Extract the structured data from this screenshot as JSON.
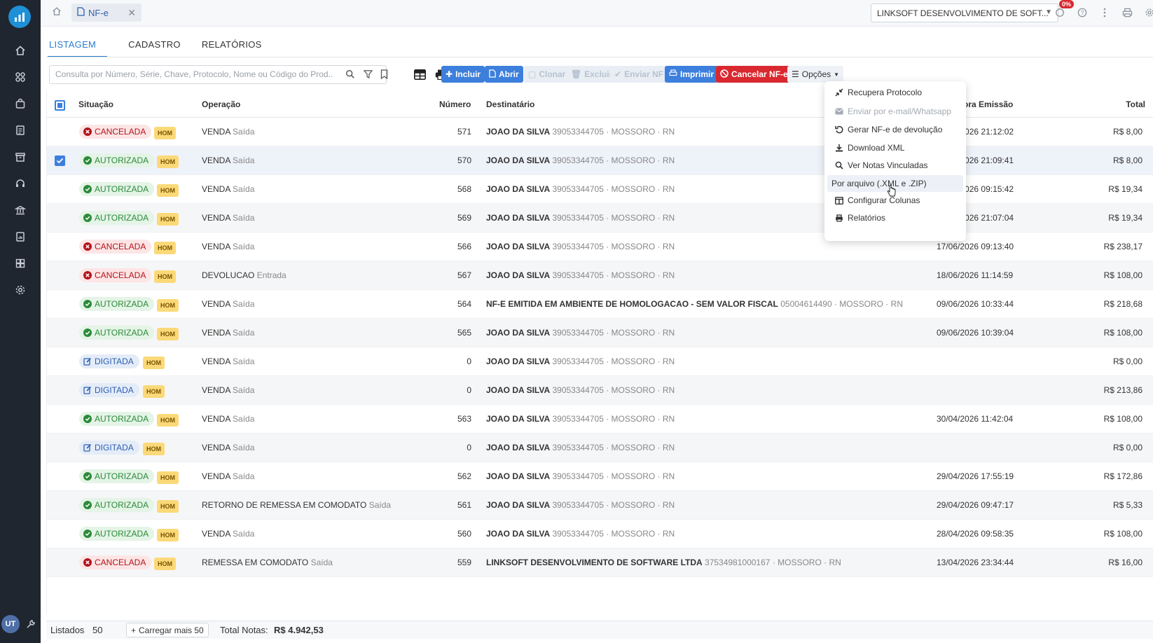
{
  "app": {
    "tab_label": "NF-e",
    "company": "LINKSOFT DESENVOLVIMENTO DE SOFT...",
    "notification_badge": "0%",
    "user_initials": "UT"
  },
  "tabs": [
    "LISTAGEM",
    "CADASTRO",
    "RELATÓRIOS"
  ],
  "search": {
    "placeholder": "Consulta por Número, Série, Chave, Protocolo, Nome ou Código do Prod..."
  },
  "toolbar": {
    "incluir": "Incluir",
    "abrir": "Abrir",
    "clonar": "Clonar",
    "excluir": "Excluir",
    "enviar": "Enviar NF",
    "imprimir": "Imprimir",
    "cancelar": "Cancelar NF-e",
    "opcoes": "Opções"
  },
  "columns": {
    "situacao": "Situação",
    "operacao": "Operação",
    "numero": "Número",
    "destinatario": "Destinatário",
    "data": "Data/Hora Emissão",
    "total": "Total"
  },
  "rows": [
    {
      "status": "CANCELADA",
      "kind": "canc",
      "env": "HOM",
      "op": "VENDA",
      "op_sub": "Saída",
      "num": "571",
      "dest": "JOAO DA SILVA",
      "dest_sub": "39053344705 · MOSSORO · RN",
      "date": "27/06/2026 21:12:02",
      "total": "R$ 8,00"
    },
    {
      "status": "AUTORIZADA",
      "kind": "aut",
      "env": "HOM",
      "op": "VENDA",
      "op_sub": "Saída",
      "num": "570",
      "dest": "JOAO DA SILVA",
      "dest_sub": "39053344705 · MOSSORO · RN",
      "date": "27/06/2026 21:09:41",
      "total": "R$ 8,00"
    },
    {
      "status": "AUTORIZADA",
      "kind": "aut",
      "env": "HOM",
      "op": "VENDA",
      "op_sub": "Saída",
      "num": "568",
      "dest": "JOAO DA SILVA",
      "dest_sub": "39053344705 · MOSSORO · RN",
      "date": "24/06/2026 09:15:42",
      "total": "R$ 19,34"
    },
    {
      "status": "AUTORIZADA",
      "kind": "aut",
      "env": "HOM",
      "op": "VENDA",
      "op_sub": "Saída",
      "num": "569",
      "dest": "JOAO DA SILVA",
      "dest_sub": "39053344705 · MOSSORO · RN",
      "date": "27/06/2026 21:07:04",
      "total": "R$ 19,34"
    },
    {
      "status": "CANCELADA",
      "kind": "canc",
      "env": "HOM",
      "op": "VENDA",
      "op_sub": "Saída",
      "num": "566",
      "dest": "JOAO DA SILVA",
      "dest_sub": "39053344705 · MOSSORO · RN",
      "date": "17/06/2026 09:13:40",
      "total": "R$ 238,17"
    },
    {
      "status": "CANCELADA",
      "kind": "canc",
      "env": "HOM",
      "op": "DEVOLUCAO",
      "op_sub": "Entrada",
      "num": "567",
      "dest": "JOAO DA SILVA",
      "dest_sub": "39053344705 · MOSSORO · RN",
      "date": "18/06/2026 11:14:59",
      "total": "R$ 108,00"
    },
    {
      "status": "AUTORIZADA",
      "kind": "aut",
      "env": "HOM",
      "op": "VENDA",
      "op_sub": "Saída",
      "num": "564",
      "dest": "NF-E EMITIDA EM AMBIENTE DE HOMOLOGACAO - SEM VALOR FISCAL",
      "dest_sub": "05004614490 · MOSSORO · RN",
      "date": "09/06/2026 10:33:44",
      "total": "R$ 218,68"
    },
    {
      "status": "AUTORIZADA",
      "kind": "aut",
      "env": "HOM",
      "op": "VENDA",
      "op_sub": "Saída",
      "num": "565",
      "dest": "JOAO DA SILVA",
      "dest_sub": "39053344705 · MOSSORO · RN",
      "date": "09/06/2026 10:39:04",
      "total": "R$ 108,00"
    },
    {
      "status": "DIGITADA",
      "kind": "dig",
      "env": "HOM",
      "op": "VENDA",
      "op_sub": "Saída",
      "num": "0",
      "dest": "JOAO DA SILVA",
      "dest_sub": "39053344705 · MOSSORO · RN",
      "date": "",
      "total": "R$ 0,00"
    },
    {
      "status": "DIGITADA",
      "kind": "dig",
      "env": "HOM",
      "op": "VENDA",
      "op_sub": "Saída",
      "num": "0",
      "dest": "JOAO DA SILVA",
      "dest_sub": "39053344705 · MOSSORO · RN",
      "date": "",
      "total": "R$ 213,86"
    },
    {
      "status": "AUTORIZADA",
      "kind": "aut",
      "env": "HOM",
      "op": "VENDA",
      "op_sub": "Saída",
      "num": "563",
      "dest": "JOAO DA SILVA",
      "dest_sub": "39053344705 · MOSSORO · RN",
      "date": "30/04/2026 11:42:04",
      "total": "R$ 108,00"
    },
    {
      "status": "DIGITADA",
      "kind": "dig",
      "env": "HOM",
      "op": "VENDA",
      "op_sub": "Saída",
      "num": "0",
      "dest": "JOAO DA SILVA",
      "dest_sub": "39053344705 · MOSSORO · RN",
      "date": "",
      "total": "R$ 0,00"
    },
    {
      "status": "AUTORIZADA",
      "kind": "aut",
      "env": "HOM",
      "op": "VENDA",
      "op_sub": "Saída",
      "num": "562",
      "dest": "JOAO DA SILVA",
      "dest_sub": "39053344705 · MOSSORO · RN",
      "date": "29/04/2026 17:55:19",
      "total": "R$ 172,86"
    },
    {
      "status": "AUTORIZADA",
      "kind": "aut",
      "env": "HOM",
      "op": "RETORNO DE REMESSA EM COMODATO",
      "op_sub": "Saída",
      "num": "561",
      "dest": "JOAO DA SILVA",
      "dest_sub": "39053344705 · MOSSORO · RN",
      "date": "29/04/2026 09:47:17",
      "total": "R$ 5,33"
    },
    {
      "status": "AUTORIZADA",
      "kind": "aut",
      "env": "HOM",
      "op": "VENDA",
      "op_sub": "Saída",
      "num": "560",
      "dest": "JOAO DA SILVA",
      "dest_sub": "39053344705 · MOSSORO · RN",
      "date": "28/04/2026 09:58:35",
      "total": "R$ 108,00"
    },
    {
      "status": "CANCELADA",
      "kind": "canc",
      "env": "HOM",
      "op": "REMESSA EM COMODATO",
      "op_sub": "Saída",
      "num": "559",
      "dest": "LINKSOFT DESENVOLVIMENTO DE SOFTWARE LTDA",
      "dest_sub": "37534981000167 · MOSSORO · RN",
      "date": "13/04/2026 23:34:44",
      "total": "R$ 16,00"
    }
  ],
  "selected_row": 1,
  "options_menu": [
    {
      "label": "Recupera Protocolo",
      "icon": "compress-arrows-icon",
      "disabled": false
    },
    {
      "label": "Enviar por e-mail/Whatsapp",
      "icon": "envelope-icon",
      "disabled": true
    },
    {
      "label": "Gerar NF-e de devolução",
      "icon": "undo-icon",
      "disabled": false
    },
    {
      "label": "Download XML",
      "icon": "download-icon",
      "disabled": false
    },
    {
      "label": "Ver Notas Vinculadas",
      "icon": "search-icon",
      "disabled": false
    },
    {
      "label": "Por arquivo (.XML e .ZIP)",
      "icon": "",
      "disabled": false
    },
    {
      "label": "Configurar Colunas",
      "icon": "columns-icon",
      "disabled": false
    },
    {
      "label": "Relatórios",
      "icon": "print-icon",
      "disabled": false
    }
  ],
  "footer": {
    "listados_label": "Listados",
    "listados_value": "50",
    "load_more": "Carregar mais 50",
    "total_label": "Total Notas:",
    "total_value": "R$ 4.942,53"
  },
  "colors": {
    "sidebar": "#1f2630",
    "primary": "#3d7fdc",
    "danger": "#d9282f",
    "authorized": "#2c8a3a",
    "env_badge": "#fbd978"
  }
}
